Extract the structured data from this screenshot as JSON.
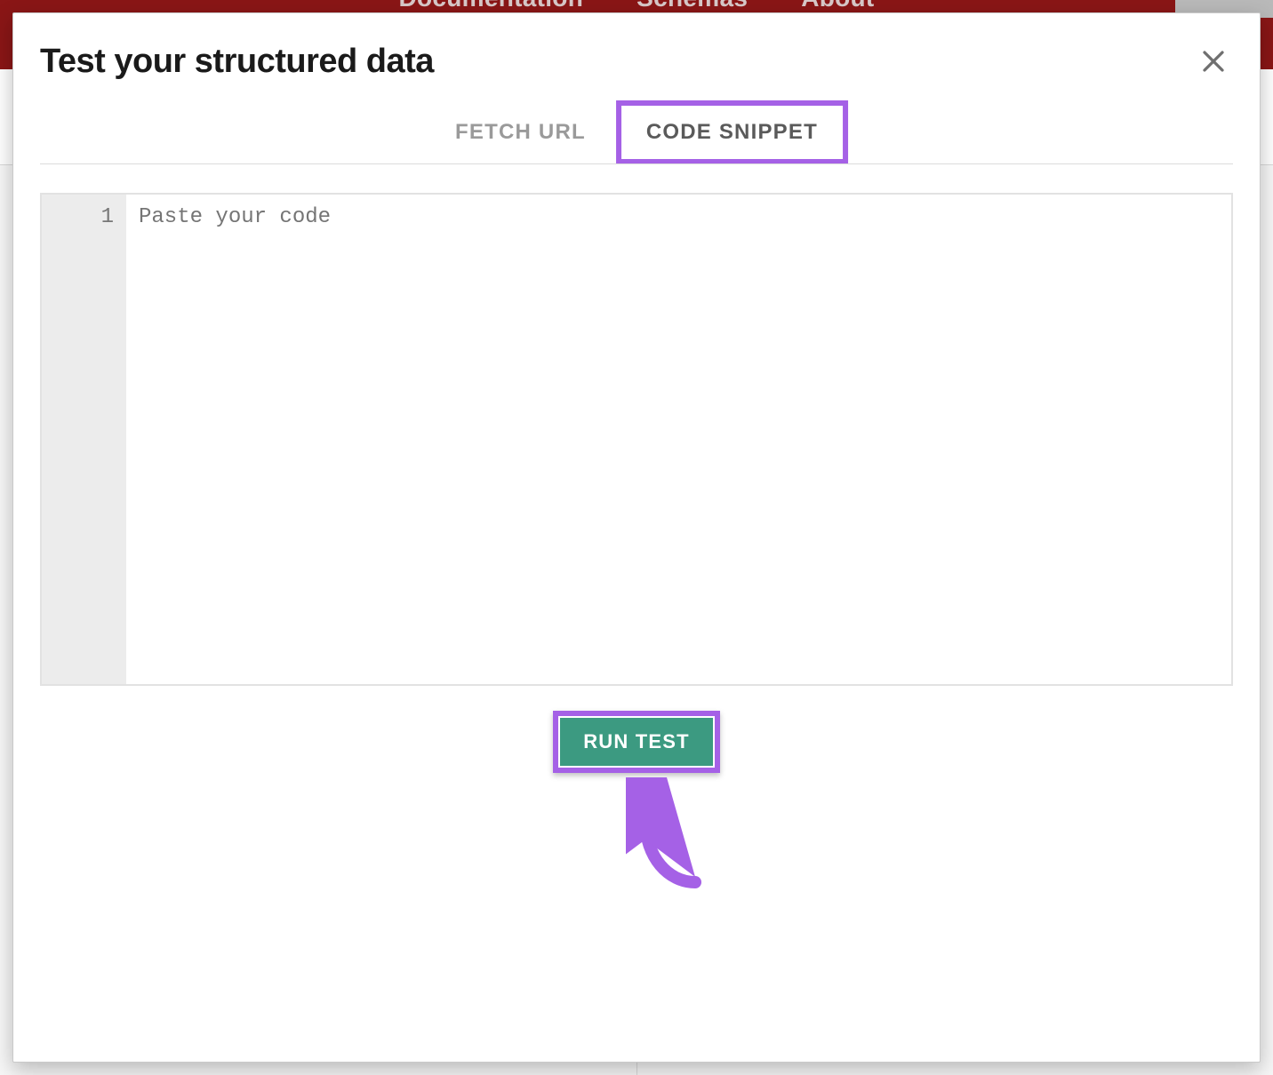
{
  "background": {
    "nav_items": [
      "Documentation",
      "Schemas",
      "About"
    ]
  },
  "modal": {
    "title": "Test your structured data",
    "tabs": {
      "fetch_url": "FETCH URL",
      "code_snippet": "CODE SNIPPET"
    },
    "editor": {
      "line_number": "1",
      "placeholder": "Paste your code"
    },
    "run_button": "RUN TEST"
  },
  "colors": {
    "highlight": "#a561e6",
    "primary_btn": "#3c9a81",
    "topbar": "#8a1616"
  }
}
